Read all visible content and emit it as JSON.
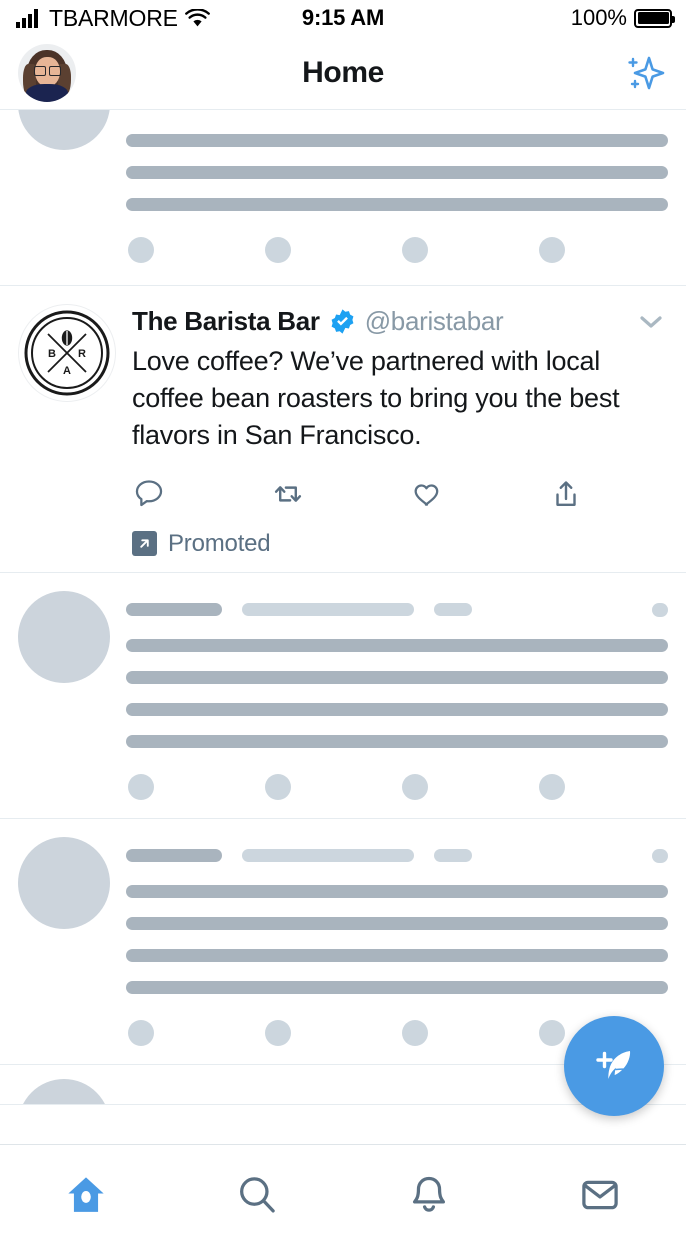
{
  "status_bar": {
    "carrier": "TBARMORE",
    "wifi_icon": "wifi-icon",
    "time": "9:15 AM",
    "battery_percent": "100%",
    "battery_icon": "battery-full-icon"
  },
  "header": {
    "title": "Home",
    "avatar_icon": "profile-avatar",
    "sparkle_icon": "sparkle-icon",
    "sparkle_color": "#4a9ae4"
  },
  "feed": {
    "promoted_tweet": {
      "display_name": "The Barista Bar",
      "handle": "@baristabar",
      "verified": true,
      "verified_icon": "verified-badge-icon",
      "avatar_icon": "barista-bar-logo",
      "avatar_letters": [
        "B",
        "R",
        "A"
      ],
      "text": "Love coffee? We’ve partnered with local coffee bean roasters to bring you the best flavors in San Francisco.",
      "caret_icon": "chevron-down-icon",
      "promoted_label": "Promoted",
      "promoted_icon": "promoted-arrow-icon",
      "actions": [
        {
          "name": "reply-button",
          "icon": "reply-icon"
        },
        {
          "name": "retweet-button",
          "icon": "retweet-icon"
        },
        {
          "name": "like-button",
          "icon": "heart-icon"
        },
        {
          "name": "share-button",
          "icon": "share-icon"
        }
      ]
    },
    "skeleton_rows": [
      {
        "clipped": true,
        "lines": 3,
        "dots": 4
      },
      {
        "clipped": false,
        "lines": 4,
        "dots": 4
      },
      {
        "clipped": false,
        "lines": 4,
        "dots": 4
      }
    ]
  },
  "compose": {
    "icon": "compose-quill-icon",
    "color": "#4a9ae4"
  },
  "bottom_nav": {
    "active_index": 0,
    "active_color": "#4a9ae4",
    "inactive_color": "#5b7083",
    "items": [
      {
        "name": "nav-home",
        "icon": "home-icon"
      },
      {
        "name": "nav-search",
        "icon": "search-icon"
      },
      {
        "name": "nav-notifications",
        "icon": "bell-icon"
      },
      {
        "name": "nav-messages",
        "icon": "envelope-icon"
      }
    ]
  }
}
